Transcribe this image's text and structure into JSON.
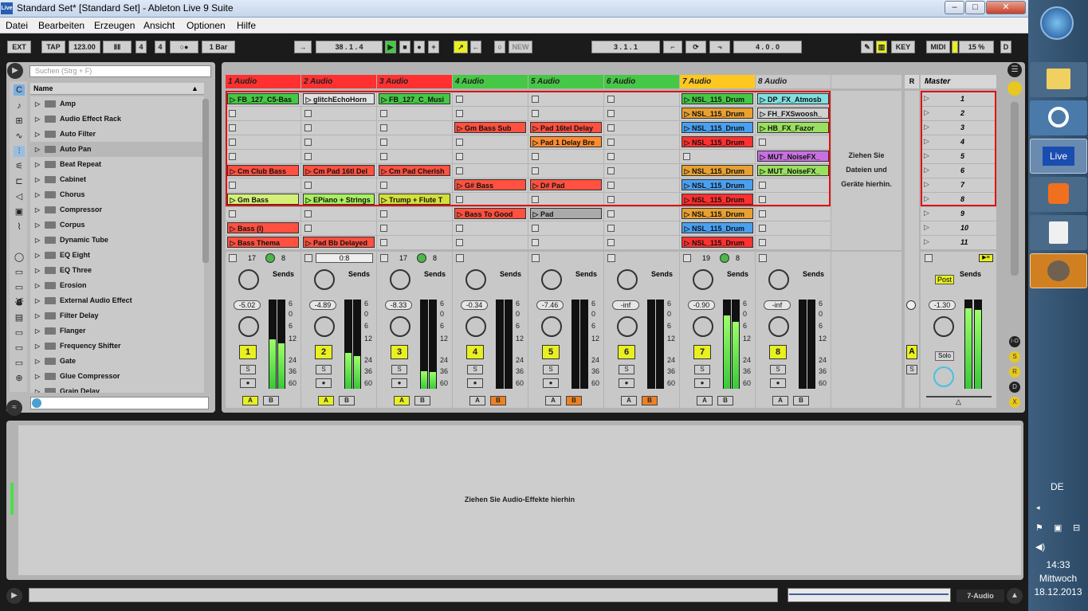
{
  "window": {
    "title": "Standard Set*  [Standard Set] - Ableton Live 9 Suite",
    "logo": "Live",
    "min": "–",
    "max": "□",
    "close": "✕"
  },
  "menu": [
    "Datei",
    "Bearbeiten",
    "Erzeugen",
    "Ansicht",
    "Optionen",
    "Hilfe"
  ],
  "transport": {
    "ext": "EXT",
    "tap": "TAP",
    "tempo": "123.00",
    "sig_num": "4",
    "sig_den": "4",
    "quant": "1 Bar",
    "position": "38 .  1 .  4",
    "new": "NEW",
    "loop_start": "3 .  1 .  1",
    "loop_len": "4 .  0 .  0",
    "key": "KEY",
    "midi": "MIDI",
    "cpu": "15 %",
    "d": "D"
  },
  "browser": {
    "search_placeholder": "Suchen (Strg + F)",
    "header": "Name",
    "items": [
      "Amp",
      "Audio Effect Rack",
      "Auto Filter",
      "Auto Pan",
      "Beat Repeat",
      "Cabinet",
      "Chorus",
      "Compressor",
      "Corpus",
      "Dynamic Tube",
      "EQ Eight",
      "EQ Three",
      "Erosion",
      "External Audio Effect",
      "Filter Delay",
      "Flanger",
      "Frequency Shifter",
      "Gate",
      "Glue Compressor",
      "Grain Delay"
    ]
  },
  "tracks": [
    {
      "name": "1 Audio",
      "color": "#ff3030",
      "vol": "-5.02",
      "num": "1",
      "ab_a": "#e8ef22",
      "ab_b": "#cfcfcf",
      "meter": 0.55
    },
    {
      "name": "2 Audio",
      "color": "#ff3030",
      "vol": "-4.89",
      "num": "2",
      "ab_a": "#e8ef22",
      "ab_b": "#cfcfcf",
      "meter": 0.4
    },
    {
      "name": "3 Audio",
      "color": "#ff3030",
      "vol": "-8.33",
      "num": "3",
      "ab_a": "#e8ef22",
      "ab_b": "#cfcfcf",
      "meter": 0.2
    },
    {
      "name": "4 Audio",
      "color": "#45c845",
      "vol": "-0.34",
      "num": "4",
      "ab_a": "#cfcfcf",
      "ab_b": "#f08020",
      "meter": 0
    },
    {
      "name": "5 Audio",
      "color": "#45c845",
      "vol": "-7.46",
      "num": "5",
      "ab_a": "#cfcfcf",
      "ab_b": "#f08020",
      "meter": 0
    },
    {
      "name": "6 Audio",
      "color": "#45c845",
      "vol": "-inf",
      "num": "6",
      "ab_a": "#cfcfcf",
      "ab_b": "#f08020",
      "meter": 0
    },
    {
      "name": "7 Audio",
      "color": "#ffc820",
      "vol": "-0.90",
      "num": "7",
      "ab_a": "#cfcfcf",
      "ab_b": "#cfcfcf",
      "meter": 0.82
    },
    {
      "name": "8 Audio",
      "color": "#c8c8c8",
      "vol": "-inf",
      "num": "8",
      "ab_a": "#cfcfcf",
      "ab_b": "#cfcfcf",
      "meter": 0
    }
  ],
  "clips": [
    [
      "FB_127_C5-Bas",
      "",
      "",
      "",
      "",
      "Cm Club Bass",
      "",
      "Gm Bass",
      "",
      "Bass (I)",
      "Bass Thema"
    ],
    [
      "glitchEchoHorn",
      "",
      "",
      "",
      "",
      "Cm Pad 16tl Del",
      "",
      "EPiano + Strings",
      "",
      "",
      "Pad Bb Delayed"
    ],
    [
      "FB_127_C_Musi",
      "",
      "",
      "",
      "",
      "Cm Pad Cherish",
      "",
      "Trump + Flute T",
      "",
      "",
      ""
    ],
    [
      "",
      "",
      "Gm Bass Sub",
      "",
      "",
      "",
      "G# Bass",
      "",
      "Bass To Good",
      "",
      ""
    ],
    [
      "",
      "",
      "Pad 16tel Delay",
      "Pad 1 Delay Bre",
      "",
      "",
      "D# Pad",
      "",
      "Pad",
      "",
      ""
    ],
    [
      "",
      "",
      "",
      "",
      "",
      "",
      "",
      "",
      "",
      "",
      ""
    ],
    [
      "NSL_115_Drum",
      "NSL_115_Drum",
      "NSL_115_Drum",
      "NSL_115_Drum",
      "",
      "NSL_115_Drum",
      "NSL_115_Drum",
      "NSL_115_Drum",
      "NSL_115_Drum",
      "NSL_115_Drum",
      "NSL_115_Drum"
    ],
    [
      "DP_FX_Atmosb",
      "FH_FXSwoosh_",
      "HB_FX_Fazor",
      "",
      "MUT_NoiseFX_",
      "MUT_NoiseFX_",
      "",
      "",
      "",
      "",
      ""
    ]
  ],
  "clip_colors": [
    [
      "#45c845",
      "",
      "",
      "",
      "",
      "#ff5040",
      "",
      "#d4f07a",
      "",
      "#ff5040",
      "#ff5040"
    ],
    [
      "#e0e0e0",
      "",
      "",
      "",
      "",
      "#ff5040",
      "",
      "#a8f060",
      "",
      "",
      "#ff5040"
    ],
    [
      "#45c845",
      "",
      "",
      "",
      "",
      "#ff5040",
      "",
      "#d4e03a",
      "",
      "",
      ""
    ],
    [
      "",
      "",
      "#ff5040",
      "",
      "",
      "",
      "#ff5040",
      "",
      "#ff5040",
      "",
      ""
    ],
    [
      "",
      "",
      "#ff5040",
      "#ff8c30",
      "",
      "",
      "#ff5040",
      "",
      "#aaaaaa",
      "",
      ""
    ],
    [
      "",
      "",
      "",
      "",
      "",
      "",
      "",
      "",
      "",
      "",
      ""
    ],
    [
      "#45c845",
      "#e8a030",
      "#4aa0f0",
      "#ff3030",
      "",
      "#e8a030",
      "#4aa0f0",
      "#ff3030",
      "#e8a030",
      "#4aa0f0",
      "#ff3030"
    ],
    [
      "#7ee0e0",
      "#d0d0d0",
      "#9ae060",
      "",
      "#c870e0",
      "#9ae060",
      "",
      "",
      "",
      "",
      ""
    ]
  ],
  "scenes": [
    "1",
    "2",
    "3",
    "4",
    "5",
    "6",
    "7",
    "8",
    "9",
    "10",
    "11"
  ],
  "drop_text": "Ziehen Sie Dateien und Geräte hierhin.",
  "master": {
    "name": "Master",
    "r": "R",
    "vol": "-1.30",
    "post": "Post",
    "solo": "Solo",
    "sends": "Sends",
    "a": "A",
    "s": "S"
  },
  "sends_label": "Sends",
  "sends_row": [
    {
      "a": "17",
      "b": "8"
    },
    {
      "c": "0:8"
    },
    {
      "a": "17",
      "b": "8"
    },
    {},
    {},
    {},
    {
      "a": "19",
      "b": "8"
    },
    {}
  ],
  "scale": [
    "6",
    "0",
    "6",
    "12",
    "24",
    "36",
    "60"
  ],
  "detail_text": "Ziehen Sie Audio-Effekte hierhin",
  "status_track": "7-Audio",
  "clock": {
    "lang": "DE",
    "time": "14:33",
    "day": "Mittwoch",
    "date": "18.12.2013"
  },
  "taskbar_live": "Live"
}
